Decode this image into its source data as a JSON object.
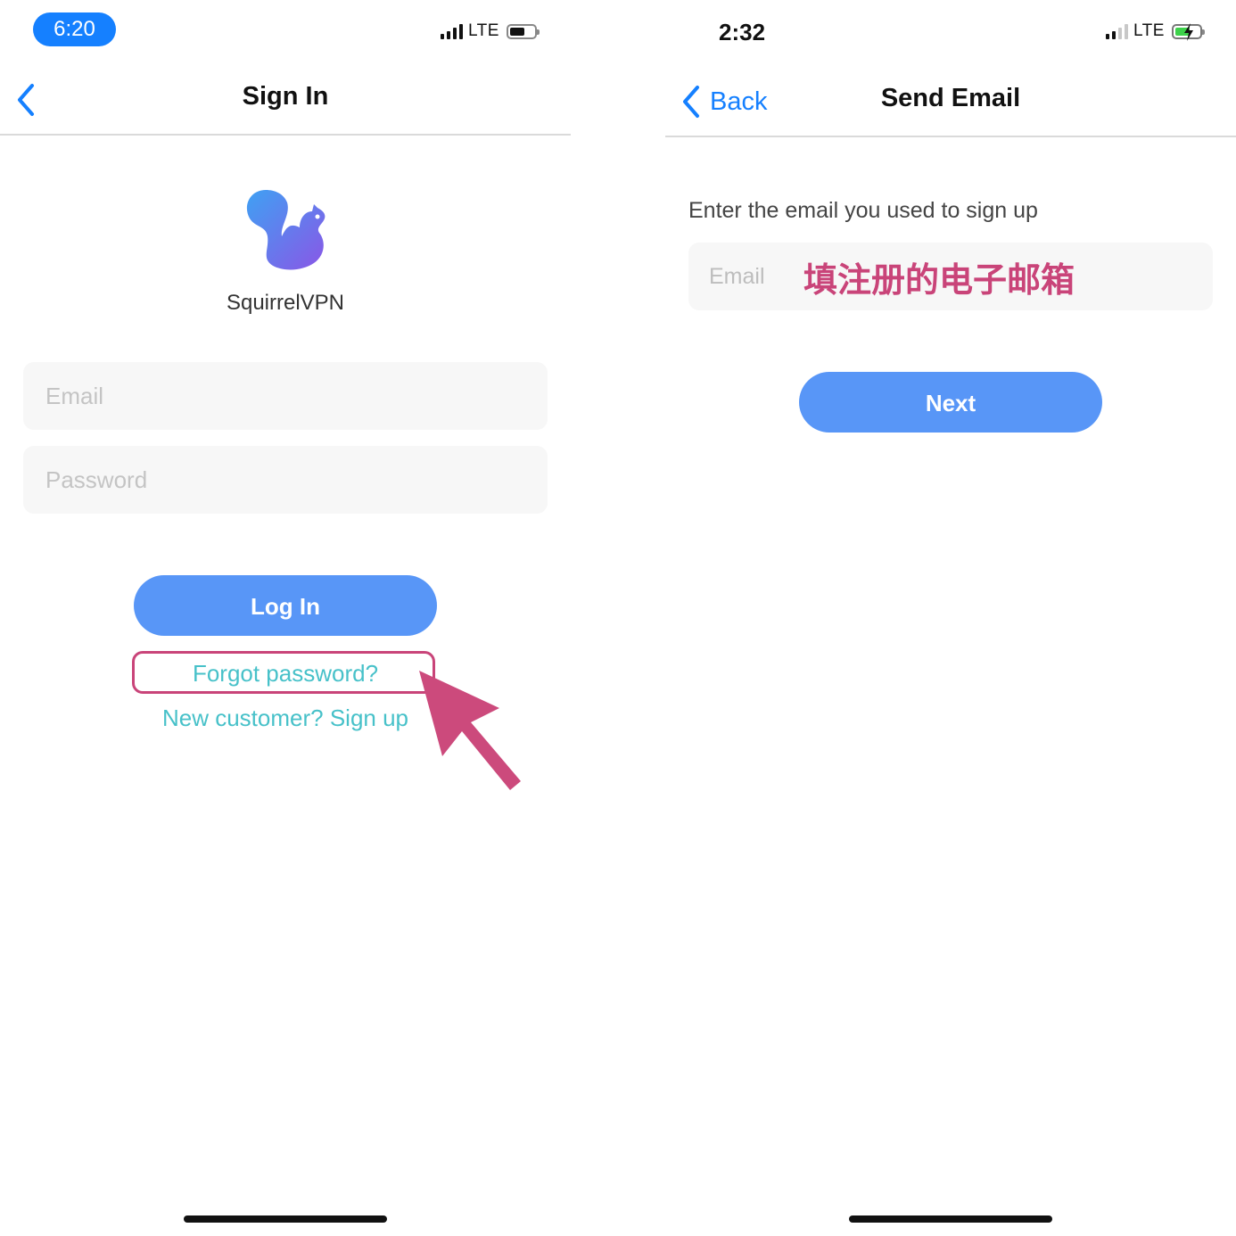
{
  "left": {
    "status": {
      "time": "6:20",
      "network": "LTE"
    },
    "nav": {
      "title": "Sign In"
    },
    "app_name": "SquirrelVPN",
    "email_placeholder": "Email",
    "password_placeholder": "Password",
    "login_label": "Log In",
    "forgot_label": "Forgot password?",
    "signup_label": "New customer? Sign up"
  },
  "right": {
    "status": {
      "time": "2:32",
      "network": "LTE"
    },
    "nav": {
      "back_label": "Back",
      "title": "Send Email"
    },
    "prompt": "Enter the email you used to sign up",
    "email_placeholder": "Email",
    "annotation": "填注册的电子邮箱",
    "next_label": "Next"
  },
  "colors": {
    "accent": "#1580ff",
    "button": "#5896f7",
    "link": "#47c1c9",
    "annotation": "#c94479"
  },
  "icons": {
    "left_back": "chevron-left-icon",
    "right_back": "chevron-left-icon",
    "logo": "squirrel-logo-icon",
    "pointer": "arrow-icon"
  }
}
